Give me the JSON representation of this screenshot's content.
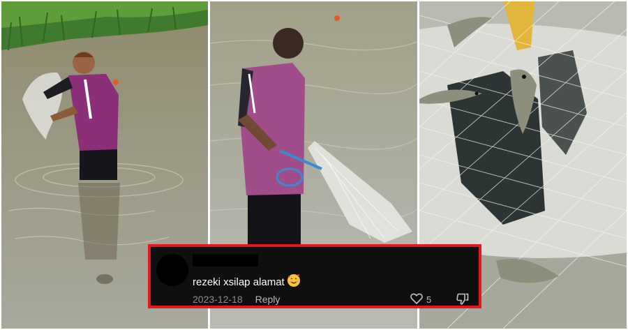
{
  "panels": [
    {
      "scene": "man-casting-net-in-river"
    },
    {
      "scene": "man-holding-fishing-net"
    },
    {
      "scene": "fish-caught-in-net"
    }
  ],
  "comment": {
    "text": "rezeki xsilap alamat",
    "emoji": "smiling-face-with-hearts-emoji",
    "date": "2023-12-18",
    "reply_label": "Reply",
    "like_count": "5",
    "highlight_color": "#e5161e",
    "background_color": "#0f0f10"
  }
}
